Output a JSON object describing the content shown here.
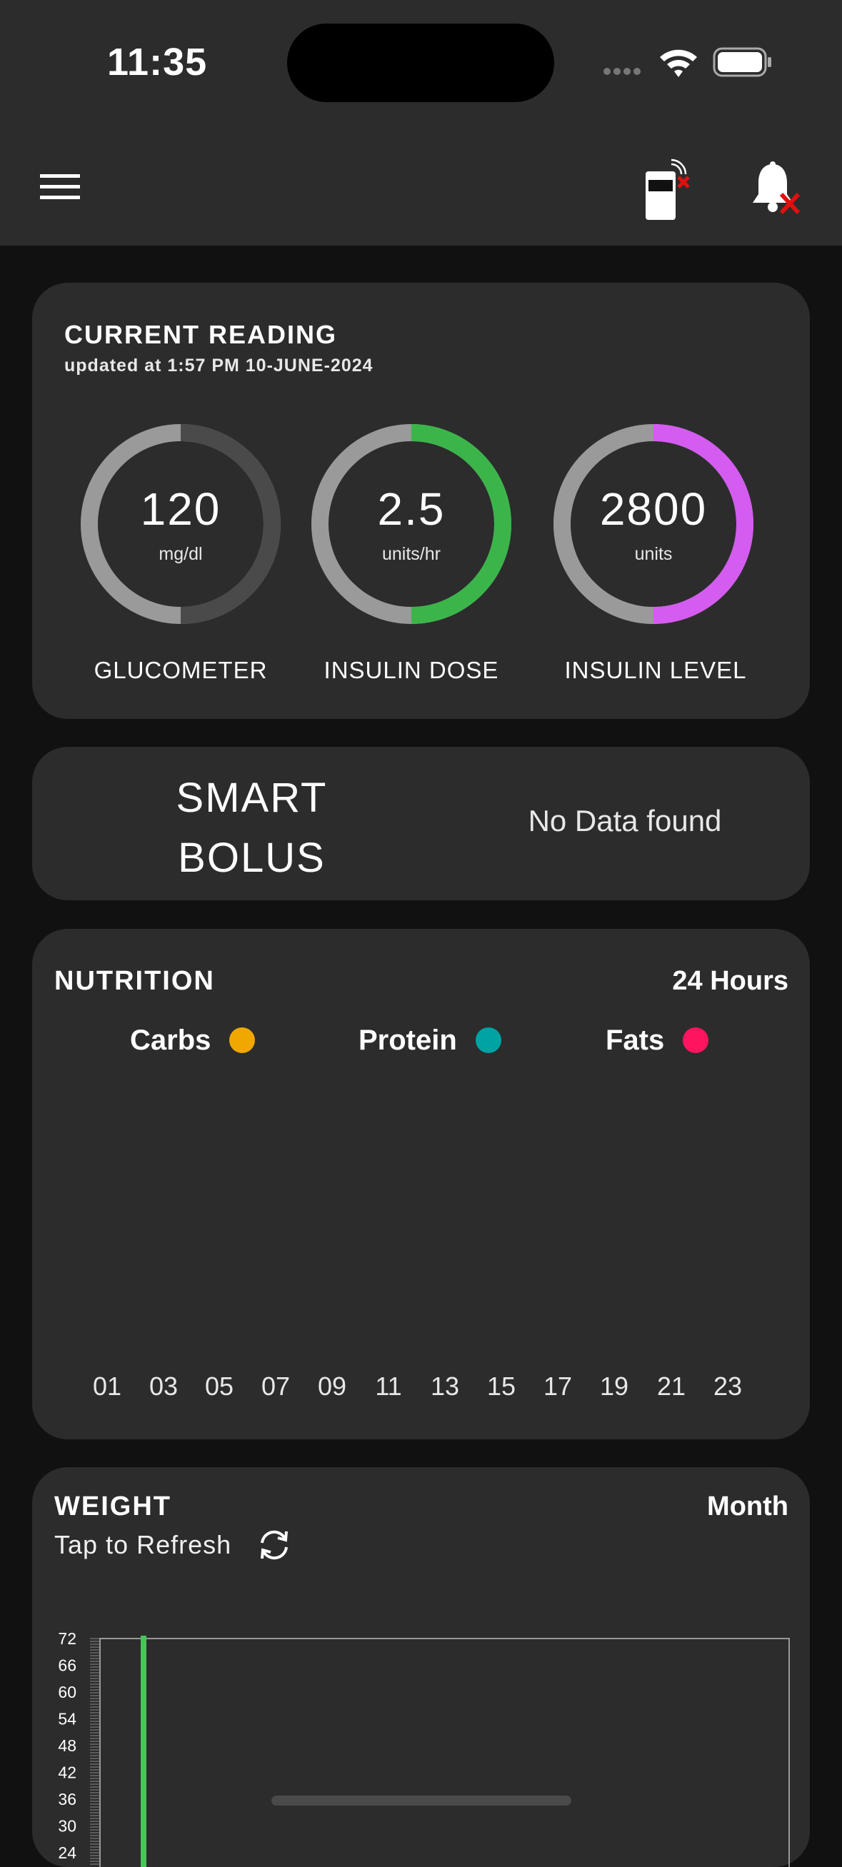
{
  "status_bar": {
    "time": "11:35"
  },
  "current_reading": {
    "title": "CURRENT READING",
    "updated": "updated at 1:57 PM  10-JUNE-2024",
    "gauges": [
      {
        "value": "120",
        "unit": "mg/dl",
        "label": "GLUCOMETER",
        "fraction": 0.5,
        "color": "#4a4a4a"
      },
      {
        "value": "2.5",
        "unit": "units/hr",
        "label": "INSULIN DOSE",
        "fraction": 0.5,
        "color": "#3bb54a"
      },
      {
        "value": "2800",
        "unit": "units",
        "label": "INSULIN LEVEL",
        "fraction": 0.5,
        "color": "#d45cf0"
      }
    ]
  },
  "smart_bolus": {
    "label_line1": "SMART",
    "label_line2": "BOLUS",
    "empty_text": "No Data found"
  },
  "nutrition": {
    "title": "NUTRITION",
    "range": "24 Hours",
    "legend": [
      {
        "name": "Carbs",
        "color": "#f0a800"
      },
      {
        "name": "Protein",
        "color": "#00a3a3"
      },
      {
        "name": "Fats",
        "color": "#ff1460"
      }
    ],
    "hours": [
      "01",
      "03",
      "05",
      "07",
      "09",
      "11",
      "13",
      "15",
      "17",
      "19",
      "21",
      "23"
    ]
  },
  "weight": {
    "title": "WEIGHT",
    "range": "Month",
    "refresh_label": "Tap to Refresh",
    "bar_color": "#48c55a"
  },
  "chart_data": {
    "type": "bar",
    "title": "WEIGHT",
    "y_ticks": [
      72,
      66,
      60,
      54,
      48,
      42,
      36,
      30,
      24
    ],
    "ylim": [
      24,
      72
    ],
    "series": [
      {
        "values": [
          72
        ]
      }
    ],
    "grid": false
  }
}
